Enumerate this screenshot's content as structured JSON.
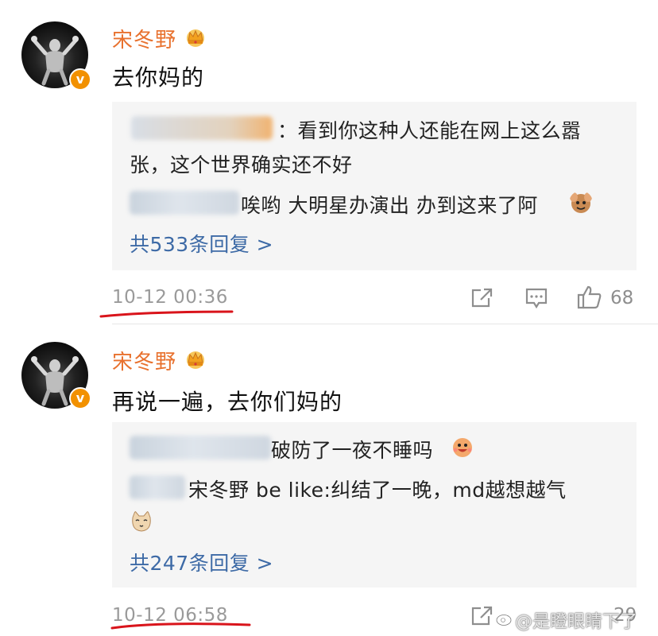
{
  "comments": [
    {
      "username": "宋冬野",
      "text": "去你妈的",
      "replies": [
        {
          "text": "：看到你这种人还能在网上这么嚣"
        },
        {
          "text": "张，这个世界确实还不好"
        },
        {
          "text": "唉哟 大明星办演出 办到这来了阿"
        }
      ],
      "more_label": "共533条回复 >",
      "timestamp": "10-12 00:36",
      "like_count": "68"
    },
    {
      "username": "宋冬野",
      "text": "再说一遍，去你们妈的",
      "replies": [
        {
          "text": "破防了一夜不睡吗"
        },
        {
          "text": "宋冬野 be like:纠结了一晚，md越想越气"
        }
      ],
      "more_label": "共247条回复 >",
      "timestamp": "10-12 06:58",
      "like_count": "29"
    }
  ],
  "watermark": "@是瞪眼睛下了",
  "colors": {
    "username": "#e8712e",
    "link": "#3d6aa6",
    "timestamp": "#9a9a9a",
    "underline": "#d9141b",
    "verified_badge": "#f29100"
  },
  "icons": [
    "avatar",
    "verified-badge-icon",
    "crown-icon",
    "share-icon",
    "comment-icon",
    "like-icon",
    "emoji-icon"
  ]
}
